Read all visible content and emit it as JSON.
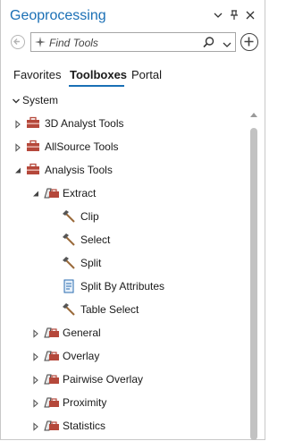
{
  "panel": {
    "title": "Geoprocessing",
    "controls": {
      "menu": "▾",
      "pin": "📌",
      "close": "✕"
    }
  },
  "search": {
    "placeholder": "Find Tools"
  },
  "tabs": [
    {
      "label": "Favorites",
      "active": false
    },
    {
      "label": "Toolboxes",
      "active": true
    },
    {
      "label": "Portal",
      "active": false
    }
  ],
  "tree": {
    "section": "System",
    "items": [
      {
        "label": "3D Analyst Tools",
        "icon": "toolbox-icon",
        "expand": "collapsed",
        "level": 0
      },
      {
        "label": "AllSource Tools",
        "icon": "toolbox-icon",
        "expand": "collapsed",
        "level": 0
      },
      {
        "label": "Analysis Tools",
        "icon": "toolbox-icon",
        "expand": "expanded",
        "level": 0
      },
      {
        "label": "Extract",
        "icon": "toolset-icon",
        "expand": "expanded",
        "level": 1
      },
      {
        "label": "Clip",
        "icon": "hammer-icon",
        "expand": "none",
        "level": 2
      },
      {
        "label": "Select",
        "icon": "hammer-icon",
        "expand": "none",
        "level": 2
      },
      {
        "label": "Split",
        "icon": "hammer-icon",
        "expand": "none",
        "level": 2
      },
      {
        "label": "Split By Attributes",
        "icon": "script-icon",
        "expand": "none",
        "level": 2
      },
      {
        "label": "Table Select",
        "icon": "hammer-icon",
        "expand": "none",
        "level": 2
      },
      {
        "label": "General",
        "icon": "toolset-icon",
        "expand": "collapsed",
        "level": 1
      },
      {
        "label": "Overlay",
        "icon": "toolset-icon",
        "expand": "collapsed",
        "level": 1
      },
      {
        "label": "Pairwise Overlay",
        "icon": "toolset-icon",
        "expand": "collapsed",
        "level": 1
      },
      {
        "label": "Proximity",
        "icon": "toolset-icon",
        "expand": "collapsed",
        "level": 1
      },
      {
        "label": "Statistics",
        "icon": "toolset-icon",
        "expand": "collapsed",
        "level": 1
      }
    ]
  },
  "colors": {
    "accent": "#1a6fb5",
    "toolbox": "#b5483b",
    "hammer": "#9a6a3a"
  }
}
